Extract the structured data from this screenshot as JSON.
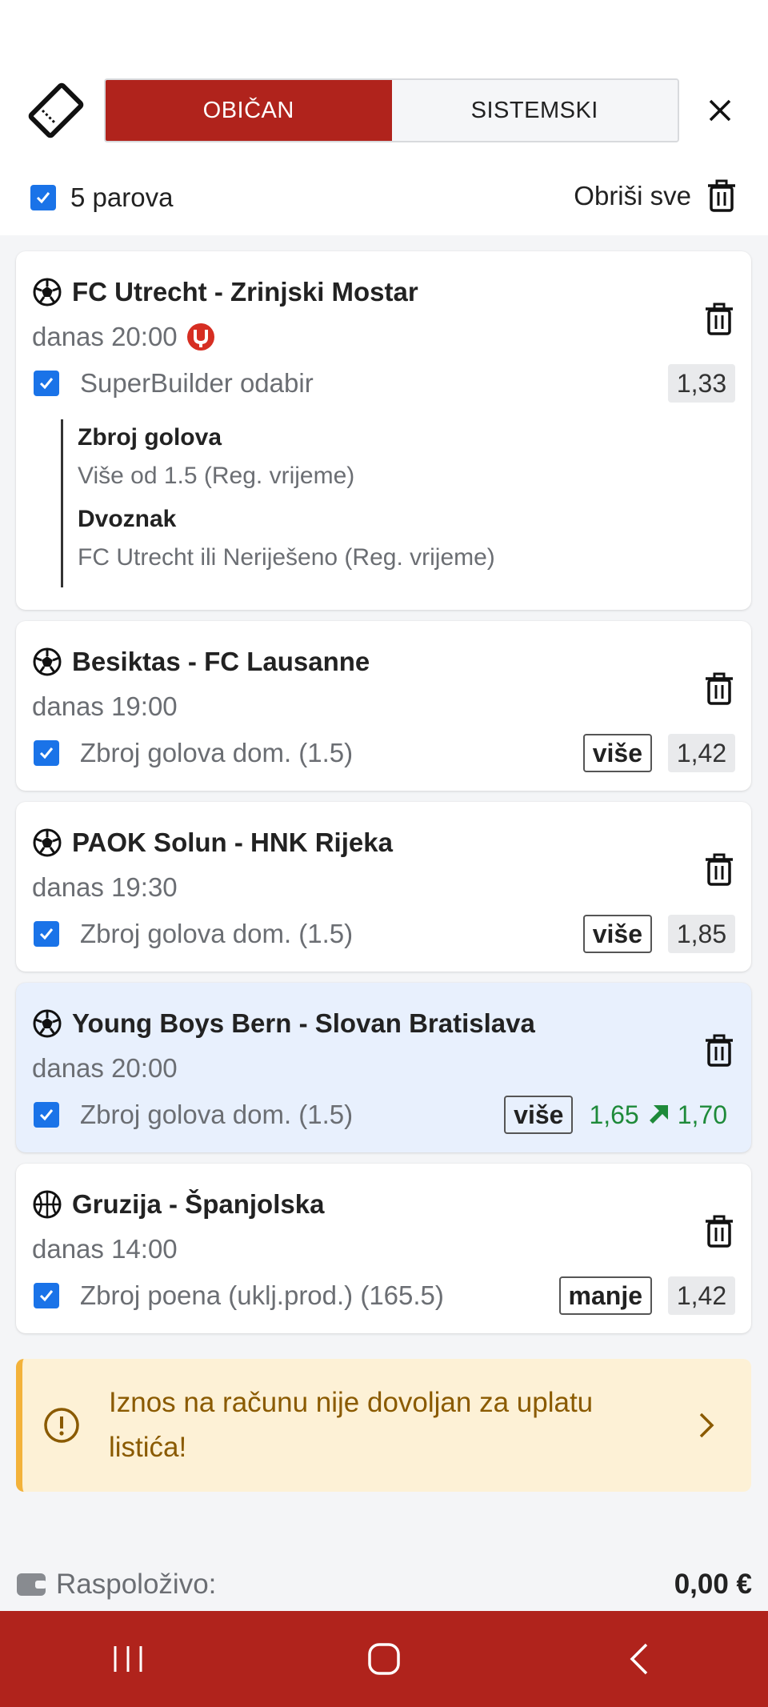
{
  "header": {
    "tabs": [
      {
        "label": "OBIČAN",
        "active": true
      },
      {
        "label": "SISTEMSKI",
        "active": false
      }
    ]
  },
  "toolbar": {
    "pairs_label": "5 parova",
    "clear_all_label": "Obriši sve"
  },
  "bets": [
    {
      "sport": "football",
      "match": "FC Utrecht - Zrinjski Mostar",
      "time": "danas 20:00",
      "selection": "SuperBuilder odabir",
      "odds": "1,33",
      "builder": [
        {
          "title": "Zbroj golova",
          "value": "Više od 1.5 (Reg. vrijeme)"
        },
        {
          "title": "Dvoznak",
          "value": "FC Utrecht ili Neriješeno (Reg. vrijeme)"
        }
      ]
    },
    {
      "sport": "football",
      "match": "Besiktas - FC Lausanne",
      "time": "danas 19:00",
      "selection": "Zbroj golova dom. (1.5)",
      "tag": "više",
      "odds": "1,42"
    },
    {
      "sport": "football",
      "match": "PAOK Solun - HNK Rijeka",
      "time": "danas 19:30",
      "selection": "Zbroj golova dom. (1.5)",
      "tag": "više",
      "odds": "1,85"
    },
    {
      "sport": "football",
      "match": "Young Boys Bern - Slovan Bratislava",
      "time": "danas 20:00",
      "selection": "Zbroj golova dom. (1.5)",
      "tag": "više",
      "odds_old": "1,65",
      "odds_new": "1,70"
    },
    {
      "sport": "basketball",
      "match": "Gruzija - Španjolska",
      "time": "danas 14:00",
      "selection": "Zbroj poena (uklj.prod.) (165.5)",
      "tag": "manje",
      "odds": "1,42"
    }
  ],
  "warning": {
    "text": "Iznos na računu nije dovoljan za uplatu listića!"
  },
  "balance": {
    "label": "Raspoloživo:",
    "value": "0,00 €"
  },
  "colors": {
    "brand": "#b0231c",
    "checkbox": "#1a73e8",
    "odds_up": "#1e8a3a",
    "warning_bg": "#fdf1d6",
    "warning_text": "#8a5a00"
  }
}
